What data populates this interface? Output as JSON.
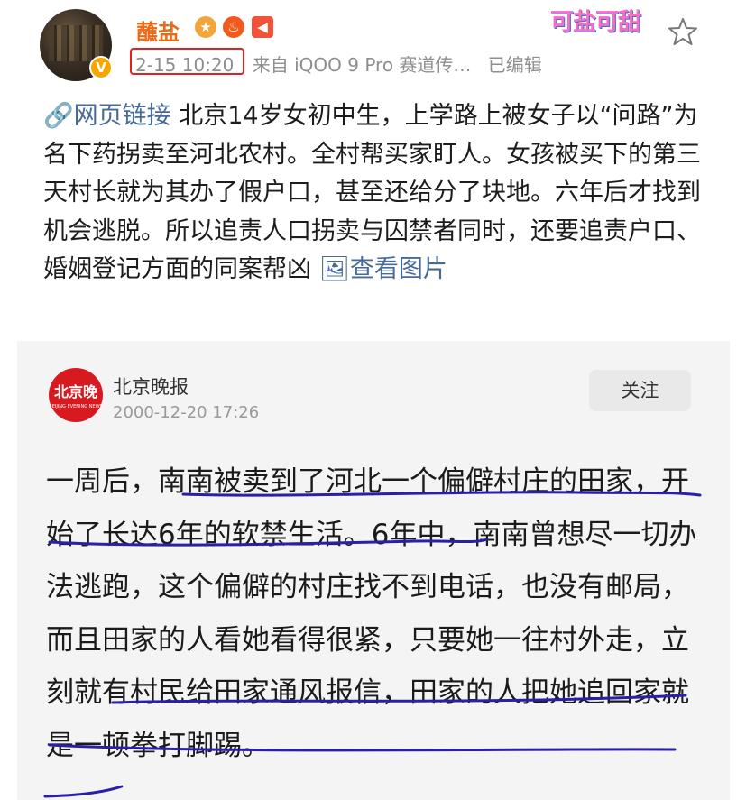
{
  "post": {
    "username": "蘸盐",
    "verified_badge": "V",
    "medals": [
      "medal-icon",
      "fire-icon",
      "megaphone-icon"
    ],
    "time": "2-15 10:20",
    "source": "来自 iQOO 9 Pro 赛道传…",
    "edited": "已编辑",
    "sticker": "可盐可甜",
    "link_label": "🔗网页链接",
    "body": " 北京14岁女初中生，上学路上被女子以“问路”为名下药拐卖至河北农村。全村帮买家盯人。女孩被买下的第三天村长就为其办了假户口，甚至还给分了块地。六年后才找到机会逃脱。所以追责人口拐卖与囚禁者同时，还要追责户口、婚姻登记方面的同案帮凶 ",
    "view_images": "🖼查看图片"
  },
  "card": {
    "logo_text": "北京晚报",
    "logo_subtext": "BEIJING EVENING NEWS",
    "source_name": "北京晚报",
    "source_date": "2000-12-20 17:26",
    "follow_label": "关注",
    "article_text": "一周后，南南被卖到了河北一个偏僻村庄的田家，开始了长达6年的软禁生活。6年中，南南曾想尽一切办法逃跑，这个偏僻的村庄找不到电话，也没有邮局，而且田家的人看她看得很紧，只要她一往村外走，立刻就有村民给田家通风报信，田家的人把她追回家就是一顿拳打脚踢。"
  },
  "colors": {
    "username": "#ec6a16",
    "link": "#476b99",
    "highlight_box": "#e02020",
    "underline": "#2a1fa8",
    "logo": "#d71920"
  }
}
